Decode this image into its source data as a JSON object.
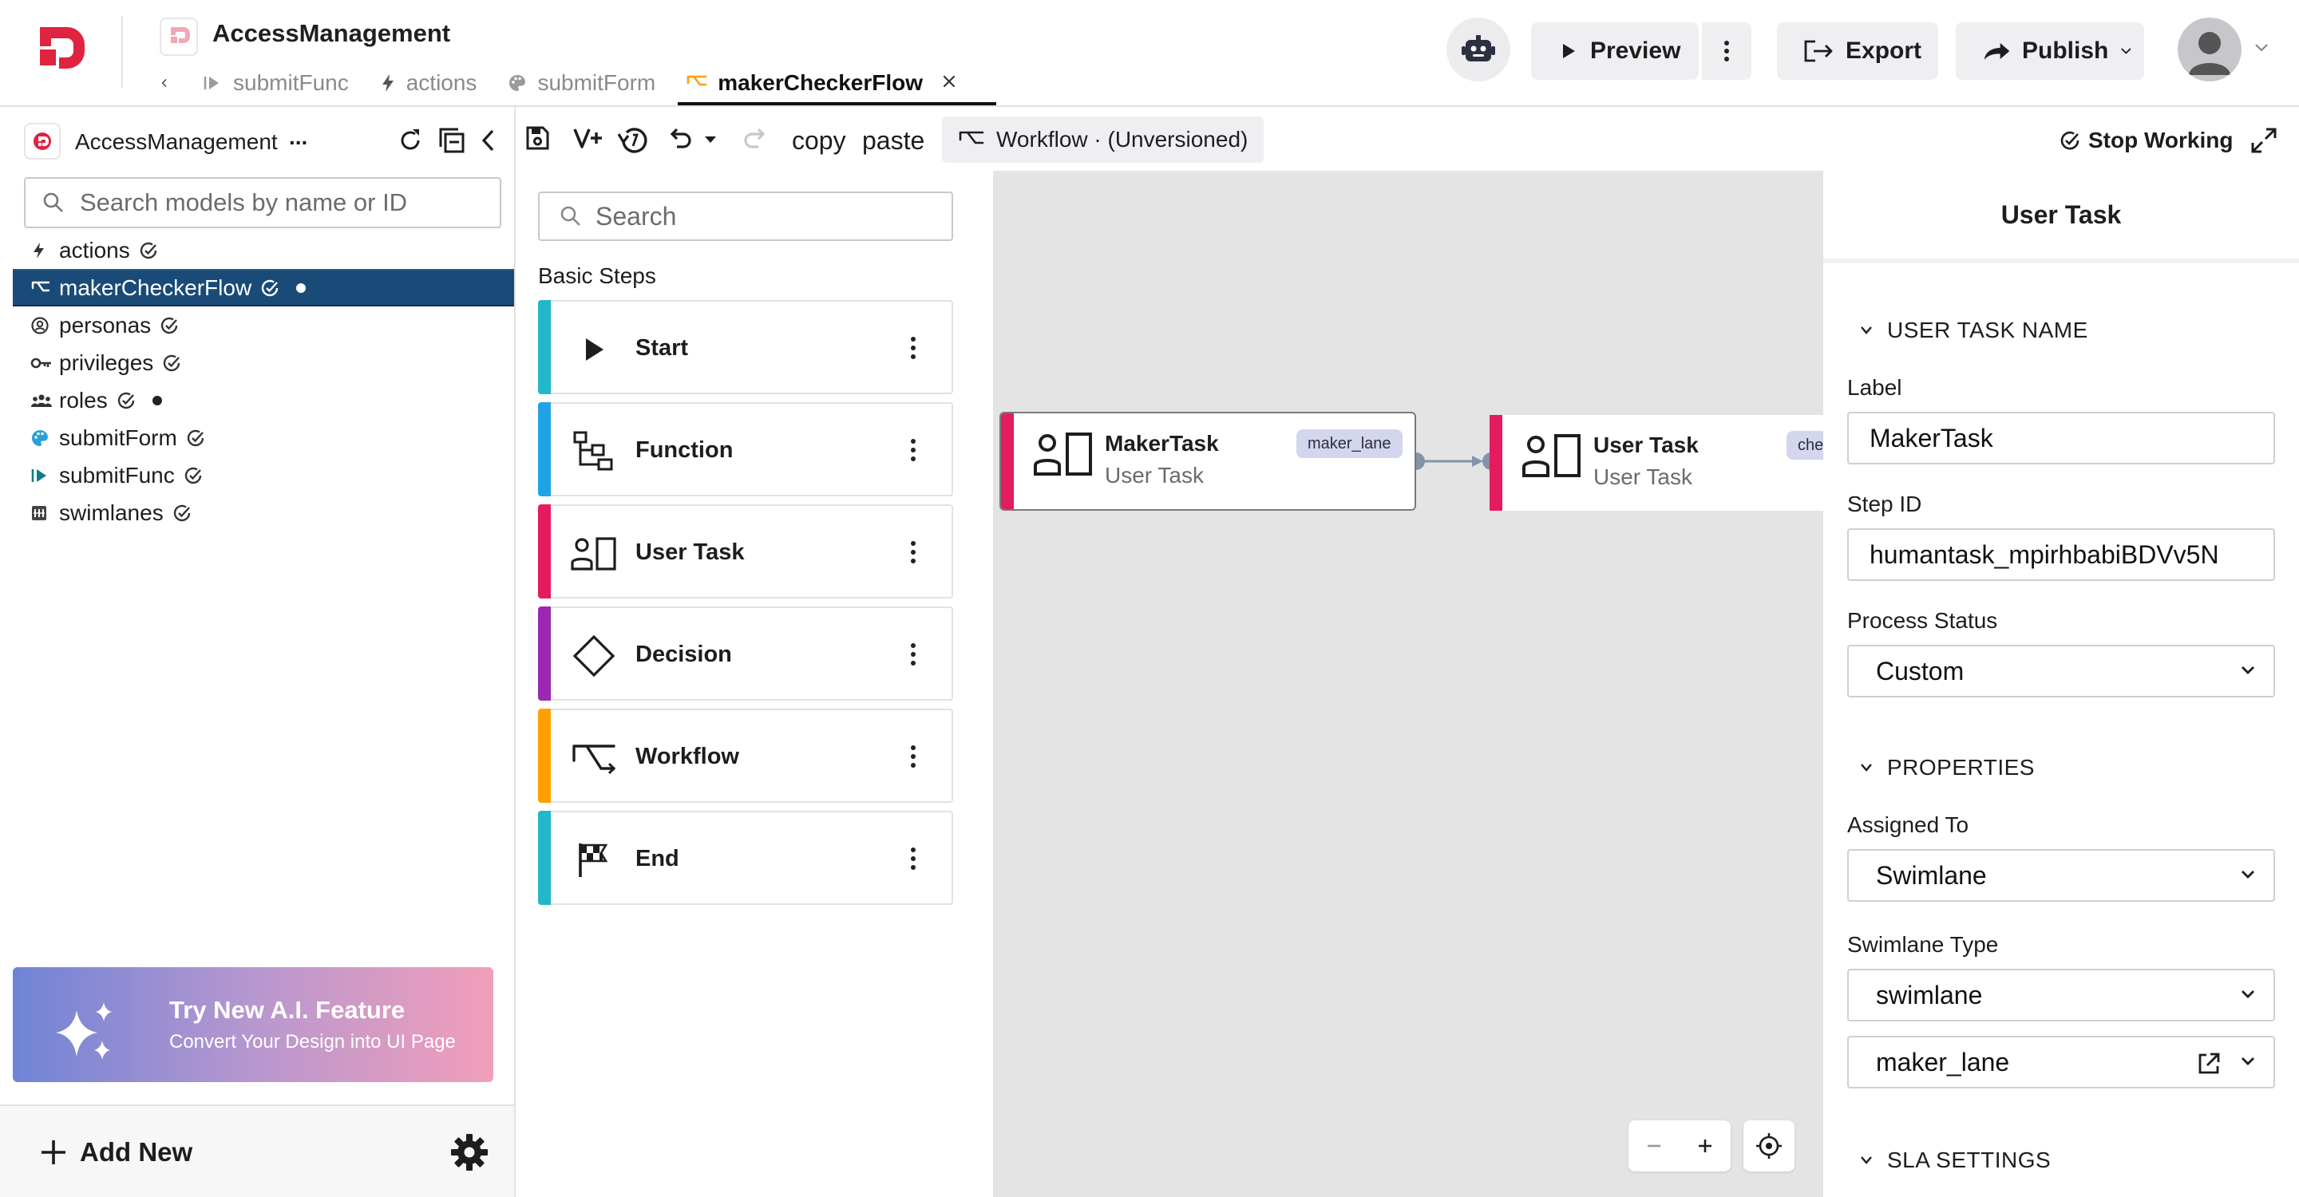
{
  "header": {
    "app_title": "AccessManagement",
    "tabs": [
      {
        "label": "submitFunc",
        "icon": "function-icon"
      },
      {
        "label": "actions",
        "icon": "lightning-icon"
      },
      {
        "label": "submitForm",
        "icon": "palette-icon"
      },
      {
        "label": "makerCheckerFlow",
        "icon": "workflow-icon",
        "active": true
      }
    ],
    "buttons": {
      "preview": "Preview",
      "export": "Export",
      "publish": "Publish"
    }
  },
  "sidebar": {
    "app_name": "AccessManagement",
    "app_name_more": "...",
    "search_placeholder": "Search models by name or ID",
    "items": [
      {
        "label": "actions",
        "icon": "lightning-icon",
        "unsaved": false
      },
      {
        "label": "makerCheckerFlow",
        "icon": "workflow-icon",
        "unsaved": true,
        "selected": true
      },
      {
        "label": "personas",
        "icon": "persona-icon",
        "unsaved": false
      },
      {
        "label": "privileges",
        "icon": "key-icon",
        "unsaved": false
      },
      {
        "label": "roles",
        "icon": "group-icon",
        "unsaved": true
      },
      {
        "label": "submitForm",
        "icon": "palette-icon",
        "unsaved": false
      },
      {
        "label": "submitFunc",
        "icon": "function-icon",
        "unsaved": false
      },
      {
        "label": "swimlanes",
        "icon": "swimlane-icon",
        "unsaved": false
      }
    ],
    "ai_banner": {
      "title": "Try New A.I. Feature",
      "subtitle": "Convert Your Design into UI Page"
    },
    "add_new": "Add New"
  },
  "toolbar": {
    "copy": "copy",
    "paste": "paste",
    "workflow_badge": "Workflow · (Unversioned)",
    "stop_working": "Stop Working"
  },
  "palette": {
    "search_placeholder": "Search",
    "heading": "Basic Steps",
    "steps": [
      {
        "label": "Start",
        "icon": "play-icon",
        "color": "#22b7c9"
      },
      {
        "label": "Function",
        "icon": "function-steps-icon",
        "color": "#1fa3e6"
      },
      {
        "label": "User Task",
        "icon": "user-task-icon",
        "color": "#e41b5e"
      },
      {
        "label": "Decision",
        "icon": "diamond-icon",
        "color": "#9c27b0"
      },
      {
        "label": "Workflow",
        "icon": "workflow-icon",
        "color": "#ffa000"
      },
      {
        "label": "End",
        "icon": "checkered-flag-icon",
        "color": "#22b7c9"
      }
    ]
  },
  "canvas": {
    "nodes": [
      {
        "title": "MakerTask",
        "subtitle": "User Task",
        "lane": "maker_lane",
        "selected": true
      },
      {
        "title": "User Task",
        "subtitle": "User Task",
        "lane": "chec"
      }
    ]
  },
  "properties": {
    "header": "User Task",
    "section_name": "USER TASK NAME",
    "label_label": "Label",
    "label_value": "MakerTask",
    "stepid_label": "Step ID",
    "stepid_value": "humantask_mpirhbabiBDVv5N",
    "status_label": "Process Status",
    "status_value": "Custom",
    "section_props": "PROPERTIES",
    "assigned_label": "Assigned To",
    "assigned_value": "Swimlane",
    "swimlane_type_label": "Swimlane Type",
    "swimlane_type_value": "swimlane",
    "swimlane_value": "maker_lane",
    "section_sla": "SLA SETTINGS"
  },
  "colors": {
    "accent_pink": "#e41b5e",
    "selected_row": "#1a4b78",
    "workflow_orange": "#ffa000",
    "logo_red": "#e0233e"
  }
}
